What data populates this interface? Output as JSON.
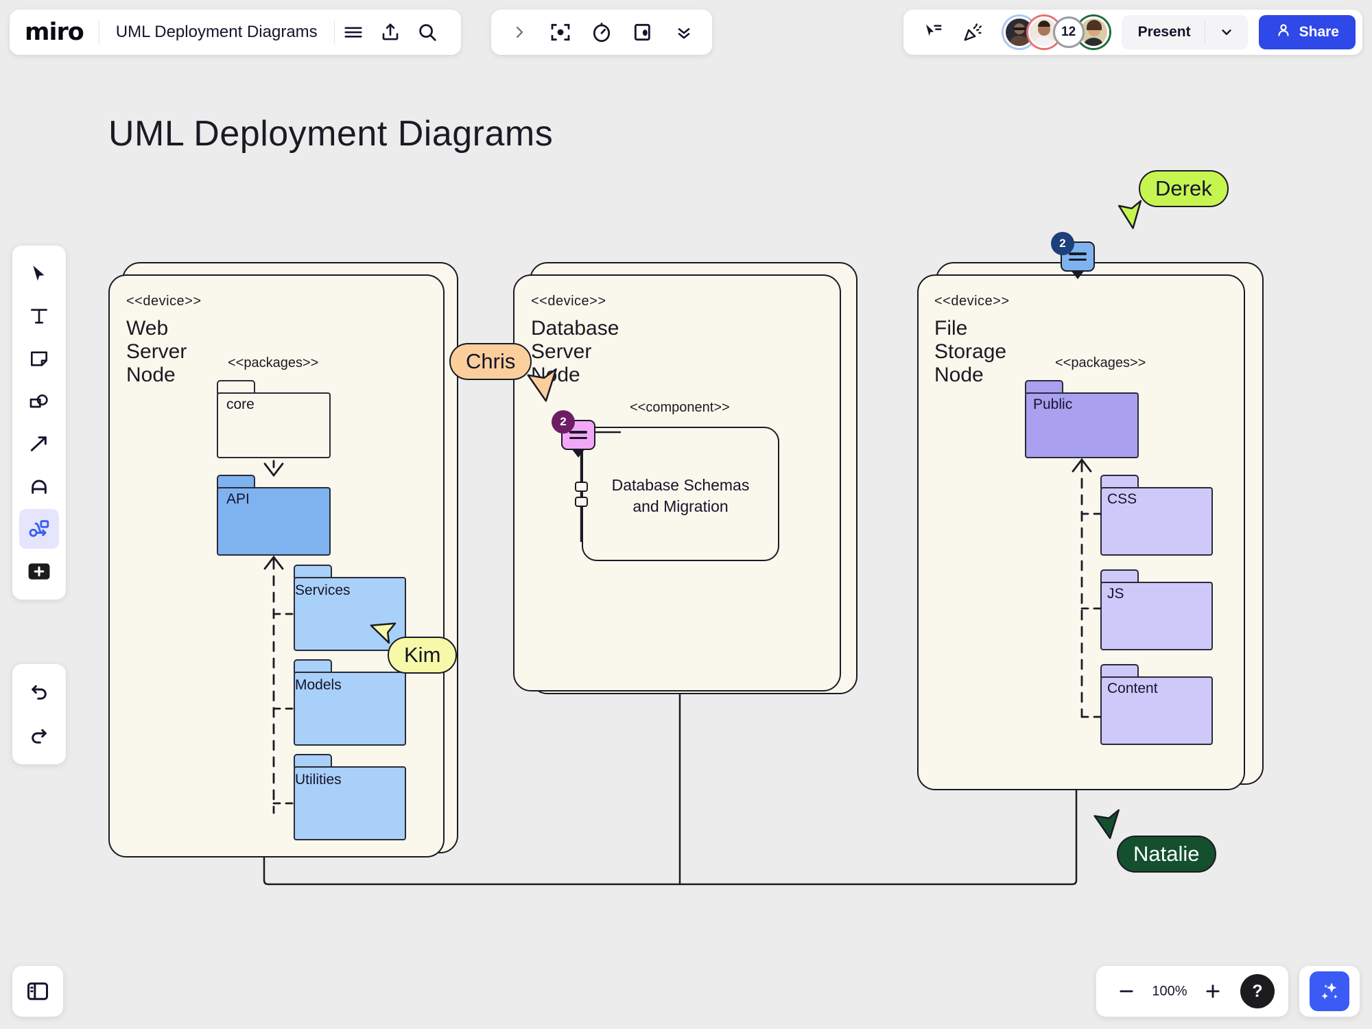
{
  "app": {
    "logo_text": "miro",
    "board_title": "UML Deployment Diagrams"
  },
  "topbar": {
    "icons": [
      {
        "name": "menu-icon",
        "label": "Menu"
      },
      {
        "name": "upload-icon",
        "label": "Upload"
      },
      {
        "name": "search-icon",
        "label": "Search"
      }
    ],
    "mid_icons": [
      {
        "name": "chevron-right-icon",
        "label": "Expand"
      },
      {
        "name": "frame-focus-icon",
        "label": "Frames"
      },
      {
        "name": "timer-icon",
        "label": "Timer"
      },
      {
        "name": "screen-share-icon",
        "label": "Screen share"
      },
      {
        "name": "chevron-double-down-icon",
        "label": "More"
      }
    ],
    "right_icons": [
      {
        "name": "cursor-share-icon",
        "label": "Cursor sharing"
      },
      {
        "name": "party-popper-icon",
        "label": "Reactions"
      }
    ],
    "collaborator_count": "12",
    "present_label": "Present",
    "share_label": "Share"
  },
  "left_toolbar": {
    "tools": [
      {
        "name": "select-tool",
        "label": "Select",
        "active": false
      },
      {
        "name": "text-tool",
        "label": "Text",
        "active": false
      },
      {
        "name": "sticky-note-tool",
        "label": "Sticky note",
        "active": false
      },
      {
        "name": "shapes-tool",
        "label": "Shapes",
        "active": false
      },
      {
        "name": "arrow-tool",
        "label": "Connection line",
        "active": false
      },
      {
        "name": "pen-tool",
        "label": "Pen",
        "active": false
      },
      {
        "name": "diagram-tool",
        "label": "Diagramming",
        "active": true
      },
      {
        "name": "more-apps-tool",
        "label": "More apps",
        "active": false
      }
    ],
    "history": [
      {
        "name": "undo-button",
        "label": "Undo"
      },
      {
        "name": "redo-button",
        "label": "Redo"
      }
    ],
    "panel_toggle_label": "Toggle panel"
  },
  "bottombar": {
    "zoom_out_label": "Zoom out",
    "zoom_level": "100%",
    "zoom_in_label": "Zoom in",
    "help_label": "?",
    "ai_label": "Miro AI"
  },
  "page": {
    "title": "UML Deployment Diagrams"
  },
  "diagram": {
    "nodes": [
      {
        "id": "web-server",
        "stereotype": "<<device>>",
        "name": "Web Server Node",
        "packages_stereotype": "<<packages>>",
        "packages": [
          {
            "name": "core",
            "color": "#faf7ec",
            "tab_color": "#faf7ec"
          },
          {
            "name": "API",
            "color": "#7fb3f0",
            "tab_color": "#7fb3f0"
          },
          {
            "name": "Services",
            "color": "#a9d0f8",
            "tab_color": "#a9d0f8"
          },
          {
            "name": "Models",
            "color": "#a9d0f8",
            "tab_color": "#a9d0f8"
          },
          {
            "name": "Utilities",
            "color": "#a9d0f8",
            "tab_color": "#a9d0f8"
          }
        ]
      },
      {
        "id": "database-server",
        "stereotype": "<<device>>",
        "name": "Database Server Node",
        "component_stereotype": "<<component>>",
        "component_label_line1": "Database Schemas",
        "component_label_line2": "and Migration"
      },
      {
        "id": "file-storage",
        "stereotype": "<<device>>",
        "name": "File Storage Node",
        "packages_stereotype": "<<packages>>",
        "packages": [
          {
            "name": "Public",
            "color": "#a9a0f0",
            "tab_color": "#a9a0f0"
          },
          {
            "name": "CSS",
            "color": "#cfc9f9",
            "tab_color": "#cfc9f9"
          },
          {
            "name": "JS",
            "color": "#cfc9f9",
            "tab_color": "#cfc9f9"
          },
          {
            "name": "Content",
            "color": "#cfc9f9",
            "tab_color": "#cfc9f9"
          }
        ]
      }
    ]
  },
  "collaborators": [
    {
      "name": "Derek",
      "bg": "#c6f54f",
      "text": "#14142b",
      "arrow": "#c6f54f"
    },
    {
      "name": "Chris",
      "bg": "#fbcf9b",
      "text": "#14142b",
      "arrow": "#fbcf9b"
    },
    {
      "name": "Kim",
      "bg": "#f7f9a8",
      "text": "#14142b",
      "arrow": "#f7f9a8"
    },
    {
      "name": "Natalie",
      "bg": "#14502e",
      "text": "#ffffff",
      "arrow": "#14502e"
    }
  ],
  "comments": [
    {
      "id": "comment-file-storage",
      "count": "2",
      "bg": "#7fb3f0",
      "badge_bg": "#1d3f7a"
    },
    {
      "id": "comment-database",
      "count": "2",
      "bg": "#f3a8f7",
      "badge_bg": "#6d1d63"
    }
  ]
}
